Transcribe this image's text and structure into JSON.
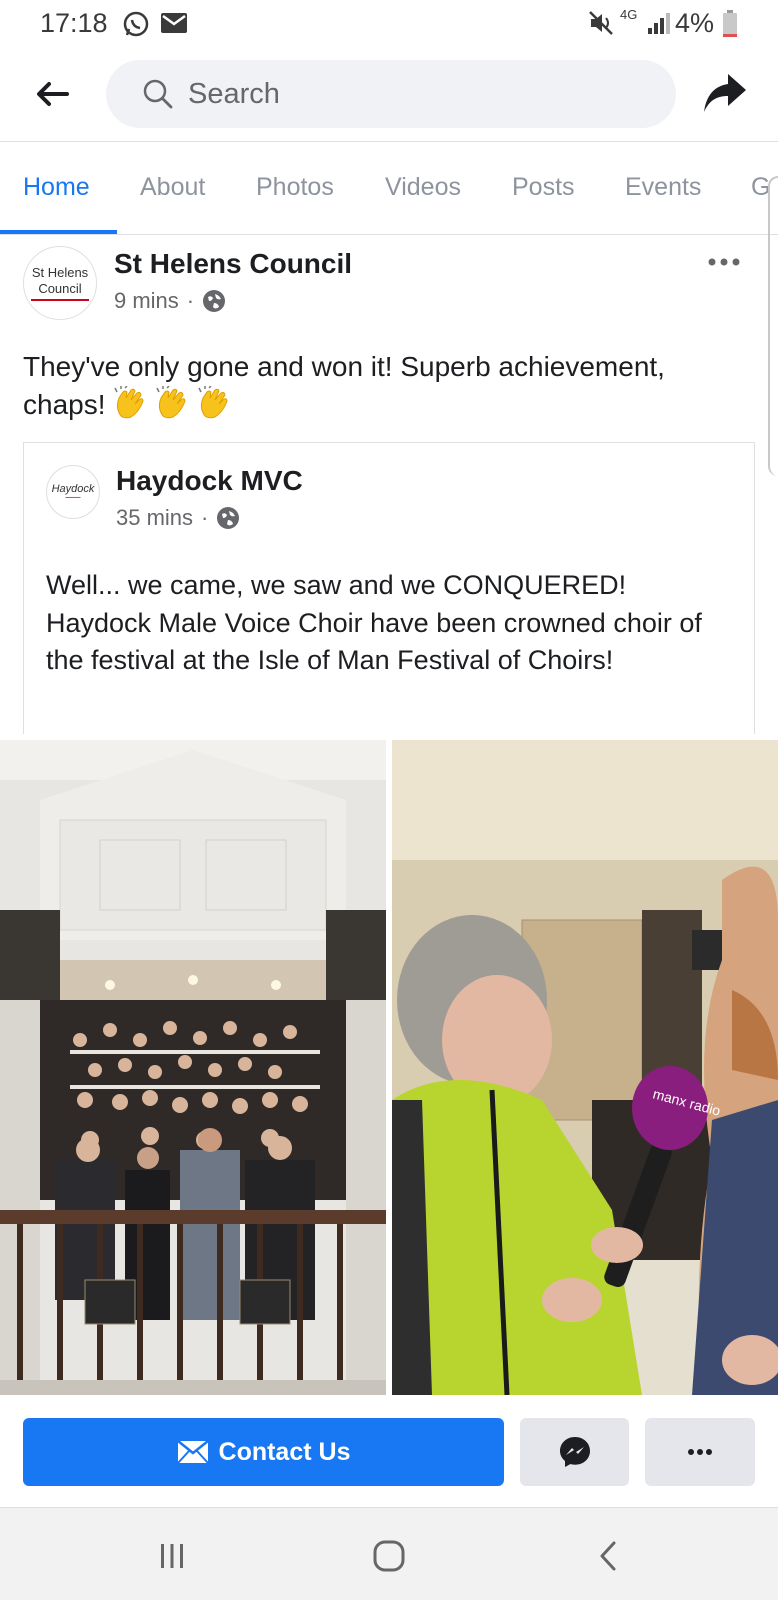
{
  "status_bar": {
    "time": "17:18",
    "network": "4G",
    "battery": "4%",
    "icons": [
      "whatsapp-icon",
      "gmail-icon",
      "mute-icon",
      "signal-icon",
      "battery-icon"
    ]
  },
  "header": {
    "search_placeholder": "Search"
  },
  "tabs": [
    {
      "label": "Home",
      "active": true
    },
    {
      "label": "About"
    },
    {
      "label": "Photos"
    },
    {
      "label": "Videos"
    },
    {
      "label": "Posts"
    },
    {
      "label": "Events"
    },
    {
      "label": "G"
    }
  ],
  "post": {
    "page_name": "St Helens Council",
    "avatar_lines": [
      "St Helens",
      "Council"
    ],
    "time": "9 mins",
    "text": "They've only gone and won it! Superb achievement, chaps!",
    "emoji_count": 3,
    "shared": {
      "page_name": "Haydock MVC",
      "avatar_text": "Haydock",
      "time": "35 mins",
      "text": "Well... we came, we saw and we CONQUERED! Haydock Male Voice Choir have been crowned choir of the festival at the Isle of Man Festival of Choirs!"
    },
    "photo_right_mic_label": "manx radio"
  },
  "actions": {
    "contact_label": "Contact Us"
  },
  "colors": {
    "accent": "#1877f2",
    "secondary_button": "#e4e6eb",
    "muted_text": "#65676b",
    "tab_inactive": "#8d949e"
  }
}
